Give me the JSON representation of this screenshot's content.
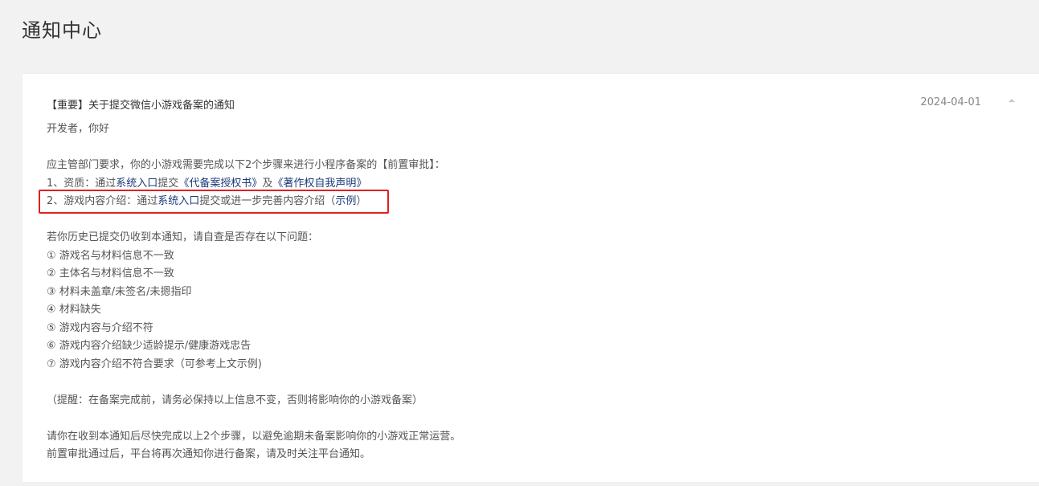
{
  "page": {
    "title": "通知中心"
  },
  "notice": {
    "title": "【重要】关于提交微信小游戏备案的通知",
    "date": "2024-04-01",
    "greeting": "开发者，你好",
    "intro": "应主管部门要求，你的小游戏需要完成以下2个步骤来进行小程序备案的【前置审批】：",
    "step1": {
      "prefix": "1、资质：通过",
      "link1": "系统入口",
      "mid1": "提交",
      "link2": "《代备案授权书》",
      "mid2": "及",
      "link3": "《著作权自我声明》"
    },
    "step2": {
      "prefix": "2、游戏内容介绍：通过",
      "link1": "系统入口",
      "mid1": "提交或进一步完善内容介绍（",
      "link2": "示例",
      "suffix": "）"
    },
    "issues_intro": "若你历史已提交仍收到本通知，请自查是否存在以下问题：",
    "issues": [
      "① 游戏名与材料信息不一致",
      "② 主体名与材料信息不一致",
      "③ 材料未盖章/未签名/未摁指印",
      "④ 材料缺失",
      "⑤ 游戏内容与介绍不符",
      "⑥ 游戏内容介绍缺少适龄提示/健康游戏忠告",
      "⑦ 游戏内容介绍不符合要求（可参考上文示例)"
    ],
    "reminder": "（提醒：在备案完成前，请务必保持以上信息不变，否则将影响你的小游戏备案）",
    "closing1": "请你在收到本通知后尽快完成以上2个步骤，以避免逾期未备案影响你的小游戏正常运营。",
    "closing2": "前置审批通过后，平台将再次通知你进行备案，请及时关注平台通知。"
  },
  "colors": {
    "highlight_border": "#e02020",
    "link": "#1a3a7a"
  }
}
